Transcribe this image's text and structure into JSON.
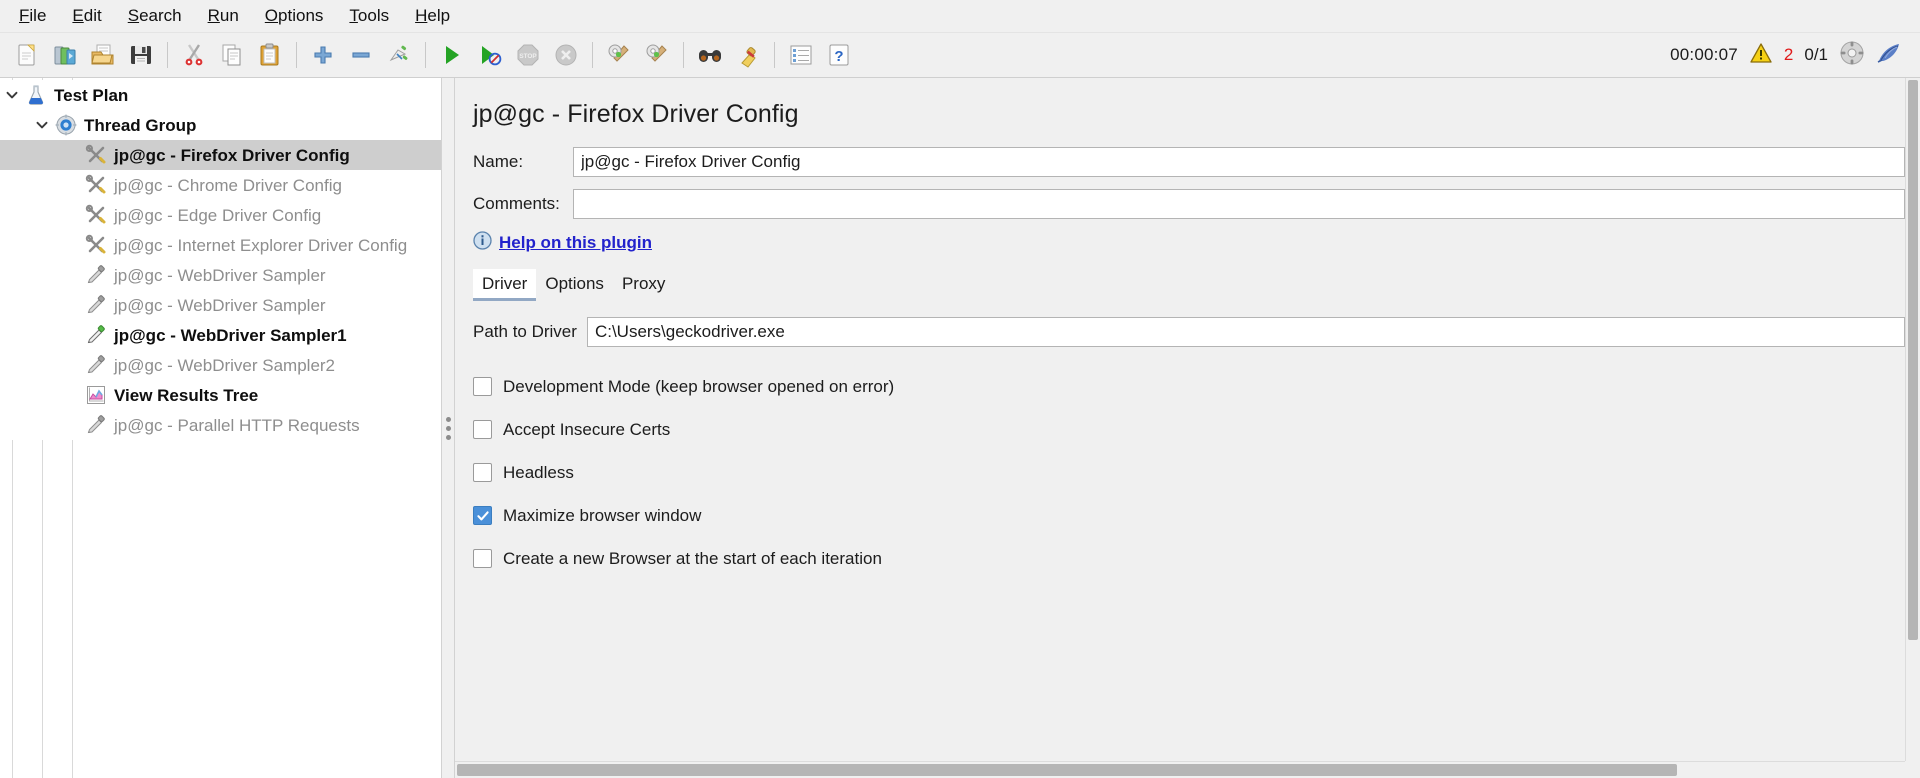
{
  "menubar": {
    "items": [
      {
        "label": "File",
        "mnemonic": "F"
      },
      {
        "label": "Edit",
        "mnemonic": "E"
      },
      {
        "label": "Search",
        "mnemonic": "S"
      },
      {
        "label": "Run",
        "mnemonic": "R"
      },
      {
        "label": "Options",
        "mnemonic": "O"
      },
      {
        "label": "Tools",
        "mnemonic": "T"
      },
      {
        "label": "Help",
        "mnemonic": "H"
      }
    ]
  },
  "toolbar": {
    "buttons": [
      {
        "name": "new-test-plan",
        "icon": "new-document-icon",
        "enabled": true
      },
      {
        "name": "templates",
        "icon": "templates-icon",
        "enabled": true
      },
      {
        "name": "open",
        "icon": "open-folder-icon",
        "enabled": true
      },
      {
        "name": "save",
        "icon": "save-disk-icon",
        "enabled": true
      },
      {
        "name": "cut",
        "icon": "scissors-icon",
        "enabled": true
      },
      {
        "name": "copy",
        "icon": "copy-icon",
        "enabled": true
      },
      {
        "name": "paste",
        "icon": "clipboard-paste-icon",
        "enabled": true
      },
      {
        "name": "expand-all",
        "icon": "plus-icon",
        "enabled": true
      },
      {
        "name": "collapse-all",
        "icon": "minus-icon",
        "enabled": true
      },
      {
        "name": "toggle",
        "icon": "toggle-icon",
        "enabled": true
      },
      {
        "name": "start",
        "icon": "play-green-icon",
        "enabled": true
      },
      {
        "name": "start-no-timers",
        "icon": "play-no-timer-icon",
        "enabled": true
      },
      {
        "name": "stop",
        "icon": "stop-sign-icon",
        "enabled": false
      },
      {
        "name": "shutdown",
        "icon": "shutdown-x-icon",
        "enabled": false
      },
      {
        "name": "clear",
        "icon": "gear-broom-icon",
        "enabled": true
      },
      {
        "name": "clear-all",
        "icon": "gear-broom-all-icon",
        "enabled": true
      },
      {
        "name": "search",
        "icon": "binoculars-icon",
        "enabled": true
      },
      {
        "name": "reset-search",
        "icon": "broom-icon",
        "enabled": true
      },
      {
        "name": "function-helper",
        "icon": "function-list-icon",
        "enabled": true
      },
      {
        "name": "help",
        "icon": "help-question-icon",
        "enabled": true
      }
    ],
    "status": {
      "timer": "00:00:07",
      "warning_icon": "warning-triangle-icon",
      "warning_count": "2",
      "threads": "0/1",
      "remote_icon": "remote-engines-icon",
      "logo_icon": "jmeter-feather-icon"
    }
  },
  "tree": {
    "nodes": [
      {
        "label": "Test Plan",
        "icon": "flask-icon",
        "depth": 0,
        "enabled": true,
        "selected": false,
        "expanded": true,
        "has_twisty": true
      },
      {
        "label": "Thread Group",
        "icon": "thread-group-gear-icon",
        "depth": 1,
        "enabled": true,
        "selected": false,
        "expanded": true,
        "has_twisty": true
      },
      {
        "label": "jp@gc - Firefox Driver Config",
        "icon": "driver-config-tools-icon",
        "depth": 2,
        "enabled": true,
        "selected": true,
        "has_twisty": false
      },
      {
        "label": "jp@gc - Chrome Driver Config",
        "icon": "driver-config-tools-icon",
        "depth": 2,
        "enabled": false,
        "selected": false,
        "has_twisty": false
      },
      {
        "label": "jp@gc - Edge Driver Config",
        "icon": "driver-config-tools-icon",
        "depth": 2,
        "enabled": false,
        "selected": false,
        "has_twisty": false
      },
      {
        "label": "jp@gc - Internet Explorer Driver Config",
        "icon": "driver-config-tools-icon",
        "depth": 2,
        "enabled": false,
        "selected": false,
        "has_twisty": false
      },
      {
        "label": "jp@gc - WebDriver Sampler",
        "icon": "sampler-pipette-icon",
        "depth": 2,
        "enabled": false,
        "selected": false,
        "has_twisty": false
      },
      {
        "label": "jp@gc - WebDriver Sampler",
        "icon": "sampler-pipette-icon",
        "depth": 2,
        "enabled": false,
        "selected": false,
        "has_twisty": false
      },
      {
        "label": "jp@gc - WebDriver Sampler1",
        "icon": "sampler-pipette-icon",
        "depth": 2,
        "enabled": true,
        "selected": false,
        "has_twisty": false
      },
      {
        "label": "jp@gc - WebDriver Sampler2",
        "icon": "sampler-pipette-icon",
        "depth": 2,
        "enabled": false,
        "selected": false,
        "has_twisty": false
      },
      {
        "label": "View Results Tree",
        "icon": "results-chart-icon",
        "depth": 2,
        "enabled": true,
        "selected": false,
        "has_twisty": false
      },
      {
        "label": "jp@gc - Parallel HTTP Requests",
        "icon": "sampler-pipette-icon",
        "depth": 2,
        "enabled": false,
        "selected": false,
        "has_twisty": false
      }
    ]
  },
  "panel": {
    "title": "jp@gc - Firefox Driver Config",
    "name_label": "Name:",
    "name_value": "jp@gc - Firefox Driver Config",
    "comments_label": "Comments:",
    "comments_value": "",
    "comments_placeholder": "",
    "help_link": "Help on this plugin",
    "help_icon": "info-circle-icon",
    "tabs": [
      {
        "label": "Driver",
        "active": true
      },
      {
        "label": "Options",
        "active": false
      },
      {
        "label": "Proxy",
        "active": false
      }
    ],
    "driver": {
      "path_label": "Path to Driver",
      "path_value": "C:\\Users\\geckodriver.exe",
      "path_placeholder": "",
      "checkboxes": [
        {
          "label": "Development Mode (keep browser opened on error)",
          "checked": false,
          "name": "development-mode-checkbox"
        },
        {
          "label": "Accept Insecure Certs",
          "checked": false,
          "name": "accept-insecure-certs-checkbox"
        },
        {
          "label": "Headless",
          "checked": false,
          "name": "headless-checkbox"
        },
        {
          "label": "Maximize browser window",
          "checked": true,
          "name": "maximize-browser-window-checkbox"
        },
        {
          "label": "Create a new Browser at the start of each iteration",
          "checked": false,
          "name": "create-new-browser-checkbox"
        }
      ]
    }
  },
  "colors": {
    "accent_checkbox": "#4a90d9",
    "link": "#2222cc",
    "warning_text": "#e01b1b",
    "selection": "#cecece",
    "panel_bg": "#f0f0f0"
  }
}
